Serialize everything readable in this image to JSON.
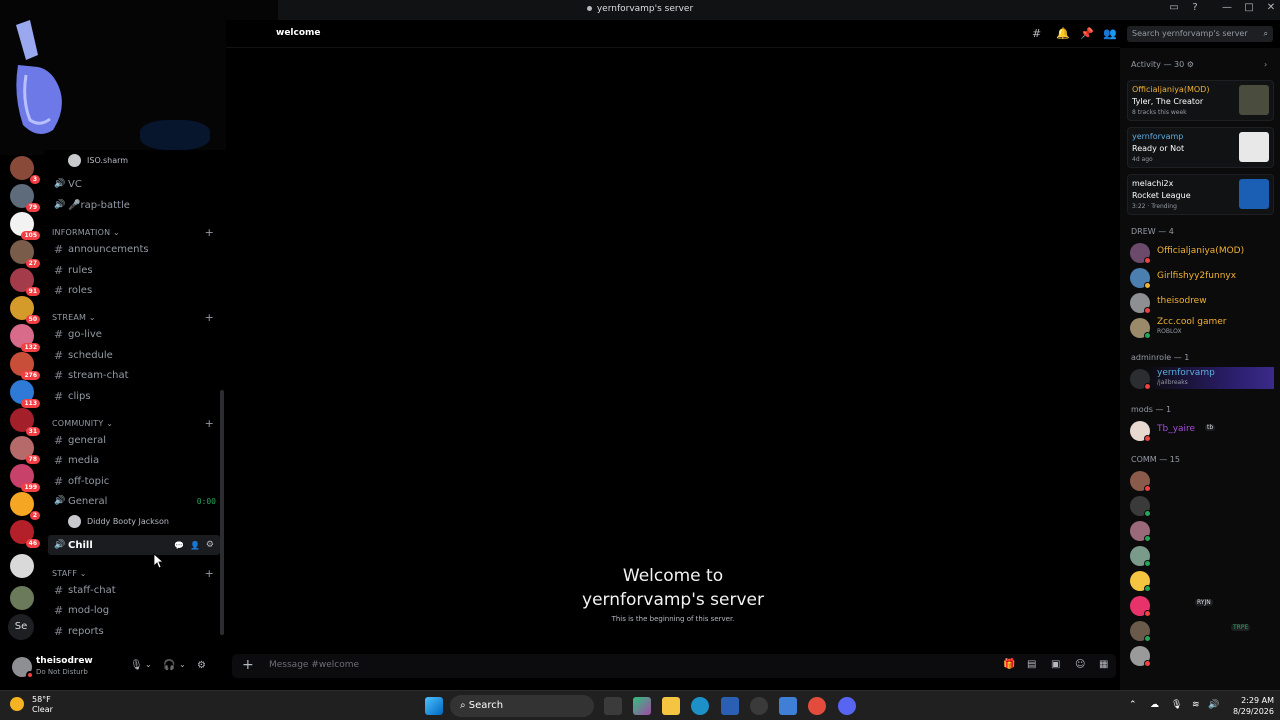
{
  "window": {
    "title": "yernforvamp's server"
  },
  "server_badges": [
    "3",
    "79",
    "105",
    "27",
    "91",
    "50",
    "132",
    "276",
    "113",
    "31",
    "78",
    "199",
    "2",
    "46"
  ],
  "server_text_icon": "Se",
  "channels": {
    "top_user": "ISO.sharm",
    "voice_top": [
      {
        "name": "VC"
      },
      {
        "name": "🎤rap-battle"
      }
    ],
    "categories": [
      {
        "name": "INFORMATION",
        "items": [
          "announcements",
          "rules",
          "roles"
        ]
      },
      {
        "name": "STREAM",
        "items": [
          "go-live",
          "schedule",
          "stream-chat",
          "clips"
        ]
      },
      {
        "name": "COMMUNITY",
        "items": [
          "general",
          "media",
          "off-topic"
        ]
      },
      {
        "name": "STAFF",
        "items": [
          "staff-chat",
          "mod-log",
          "reports"
        ]
      }
    ],
    "voice_general": {
      "name": "General",
      "timer": "0:00",
      "user": "Diddy Booty Jackson"
    },
    "voice_chill": {
      "name": "Chill"
    }
  },
  "user": {
    "name": "theisodrew",
    "status": "Do Not Disturb"
  },
  "header": {
    "channel": "welcome",
    "search_placeholder": "Search yernforvamp's server"
  },
  "welcome": {
    "title_line1": "Welcome to",
    "title_line2": "yernforvamp's server",
    "subtitle": "This is the beginning of this server."
  },
  "composer": {
    "placeholder": "Message #welcome"
  },
  "activity": {
    "heading": "Activity — 30",
    "cards": [
      {
        "user": "Officialjaniya(MOD)",
        "game": "Tyler, The Creator",
        "meta": "8 tracks this week",
        "user_color": "#f0b232"
      },
      {
        "user": "yernforvamp",
        "game": "Ready or Not",
        "meta": "4d ago",
        "user_color": "#5dade2"
      },
      {
        "user": "melachi2x",
        "game": "Rocket League",
        "meta": "3:22 · Trending",
        "user_color": "#ffffff"
      }
    ]
  },
  "members": {
    "groups": [
      {
        "title": "DREW — 4",
        "members": [
          {
            "name": "Officialjaniya(MOD)",
            "color": "#f0b232",
            "status": "dnd"
          },
          {
            "name": "Girlfishyy2funnyx",
            "color": "#f0b232",
            "status": "idle"
          },
          {
            "name": "theisodrew",
            "color": "#f0b232",
            "status": "dnd"
          },
          {
            "name": "Zcc.cool gamer",
            "color": "#f0b232",
            "status": "online",
            "sub": "ROBLOX"
          }
        ]
      },
      {
        "title": "adminrole — 1",
        "members": [
          {
            "name": "yernforvamp",
            "color": "#5dade2",
            "status": "dnd",
            "sub": "/jailbreaks"
          }
        ]
      },
      {
        "title": "mods — 1",
        "members": [
          {
            "name": "Tb_yaire",
            "color": "#a64ddb",
            "status": "dnd",
            "tag": "tb"
          }
        ]
      },
      {
        "title": "COMM — 15",
        "members": [
          {
            "name": "",
            "color": "#1a2a8a",
            "status": "dnd"
          },
          {
            "name": "",
            "color": "#1a2a8a",
            "status": "online"
          },
          {
            "name": "",
            "color": "#1a2a8a",
            "status": "online"
          },
          {
            "name": "",
            "color": "#1a2a8a",
            "status": "online"
          },
          {
            "name": "",
            "color": "#1a2a8a",
            "status": "online"
          },
          {
            "name": "",
            "color": "#1a2a8a",
            "status": "dnd",
            "tag": "RYJN"
          },
          {
            "name": "",
            "color": "#1a2a8a",
            "status": "online",
            "tag": "TRPE"
          },
          {
            "name": "",
            "color": "#1a2a8a",
            "status": "dnd"
          }
        ]
      }
    ]
  },
  "taskbar": {
    "weather_temp": "58°F",
    "weather_cond": "Clear",
    "search_label": "Search",
    "time": "2:29 AM",
    "date": "8/29/2026"
  }
}
